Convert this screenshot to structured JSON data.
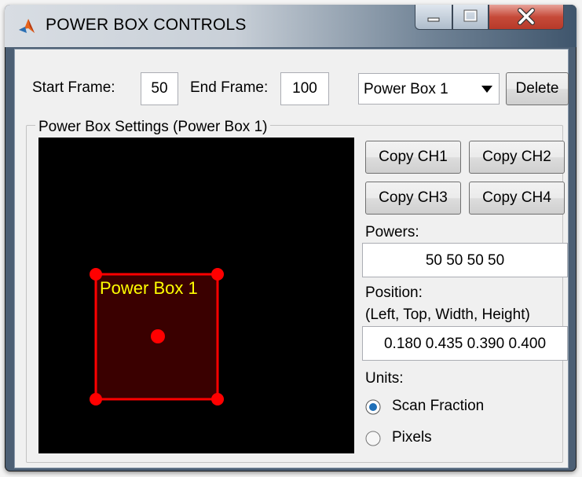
{
  "window": {
    "title": "POWER BOX CONTROLS"
  },
  "frames": {
    "start_label": "Start Frame:",
    "start_value": "50",
    "end_label": "End Frame:",
    "end_value": "100"
  },
  "box_select": {
    "selected": "Power Box 1"
  },
  "delete_label": "Delete",
  "settings": {
    "legend": "Power Box Settings (Power Box 1)",
    "copy_buttons": [
      "Copy CH1",
      "Copy CH2",
      "Copy CH3",
      "Copy CH4"
    ],
    "powers_label": "Powers:",
    "powers_value": "50  50  50  50",
    "position_label": "Position:",
    "position_sublabel": "(Left, Top, Width, Height)",
    "position_value": "0.180 0.435 0.390 0.400",
    "units_label": "Units:",
    "units_options": [
      "Scan Fraction",
      "Pixels"
    ],
    "units_selected": "Scan Fraction"
  },
  "canvas": {
    "box_label": "Power Box 1"
  },
  "colors": {
    "box": "#ff0000",
    "box_fill": "#3a0000",
    "box_label": "#ffff00",
    "canvas_bg": "#000000"
  }
}
